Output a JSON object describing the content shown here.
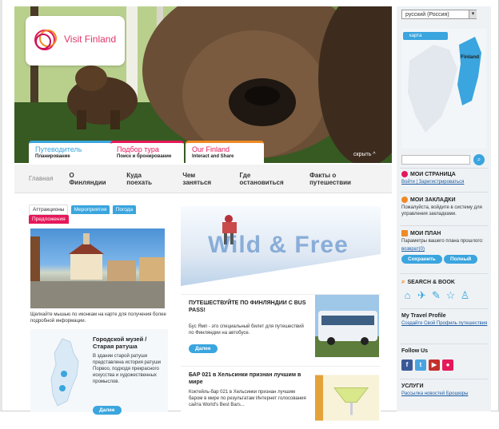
{
  "logo": {
    "text": "Visit Finland"
  },
  "hero_tabs": [
    {
      "title": "Путеводитель",
      "subtitle": "Планирование"
    },
    {
      "title": "Подбор тура",
      "subtitle": "Поиск и бронирование"
    },
    {
      "title": "Our Finland",
      "subtitle": "Interact and Share"
    }
  ],
  "collapse_label": "скрыть ^",
  "nav": [
    "Главная",
    "О Финляндии",
    "Куда поехать",
    "Чем заняться",
    "Где остановиться",
    "Факты о путешествии"
  ],
  "left_tabs": [
    "Аттракционы",
    "Мероприятия",
    "Погода",
    "Предложения"
  ],
  "caption": "Щелкайте мышью по иконкам на карте для получения более подробной информации.",
  "museum": {
    "title": "Городской музей / Старая ратуша",
    "body": "В здании старой ратуши представлена история ратуши Порвоо, подходя прекрасного искусства и художественных промыслов.",
    "button": "Далее"
  },
  "wild_text": "Wild & Free",
  "cards": [
    {
      "title": "ПУТЕШЕСТВУЙТЕ ПО ФИНЛЯНДИИ С BUS PASS!",
      "body": "Бус Ямп - это специальный билет для путешествий по Финляндии на автобусе.",
      "button": "Далее"
    },
    {
      "title": "БАР 021 в Хельсинки признан лучшим в мире",
      "body": "Коктейль-бар 021 в Хельсинки признан лучшим баром в мире по результатам Интернет голосования сайта World's Best Bars..."
    }
  ],
  "sidebar": {
    "language": "русский (Россия)",
    "map_button": "карта",
    "map_label": "Finland",
    "my_page": {
      "title": "МОИ СТРАНИЦА",
      "links": "Войти | Зарегистрироваться"
    },
    "bookmarks": {
      "title": "МОИ ЗАКЛАДКИ",
      "text": "Пожалуйста, войдите в систему для управления закладками."
    },
    "trip": {
      "title": "МОИ ПЛАН",
      "text": "Параметры вашего плана прошлого:",
      "link": "возврат(0)",
      "btn1": "Сохранить",
      "btn2": "Полный"
    },
    "search_book": {
      "title": "SEARCH & BOOK"
    },
    "travel_profile": {
      "title": "My Travel Profile",
      "text": "Создайте Свой Профиль путешествия"
    },
    "follow": {
      "title": "Follow Us"
    },
    "services": {
      "title": "УСЛУГИ",
      "text": "Рассылка новостей Брошюры"
    }
  }
}
